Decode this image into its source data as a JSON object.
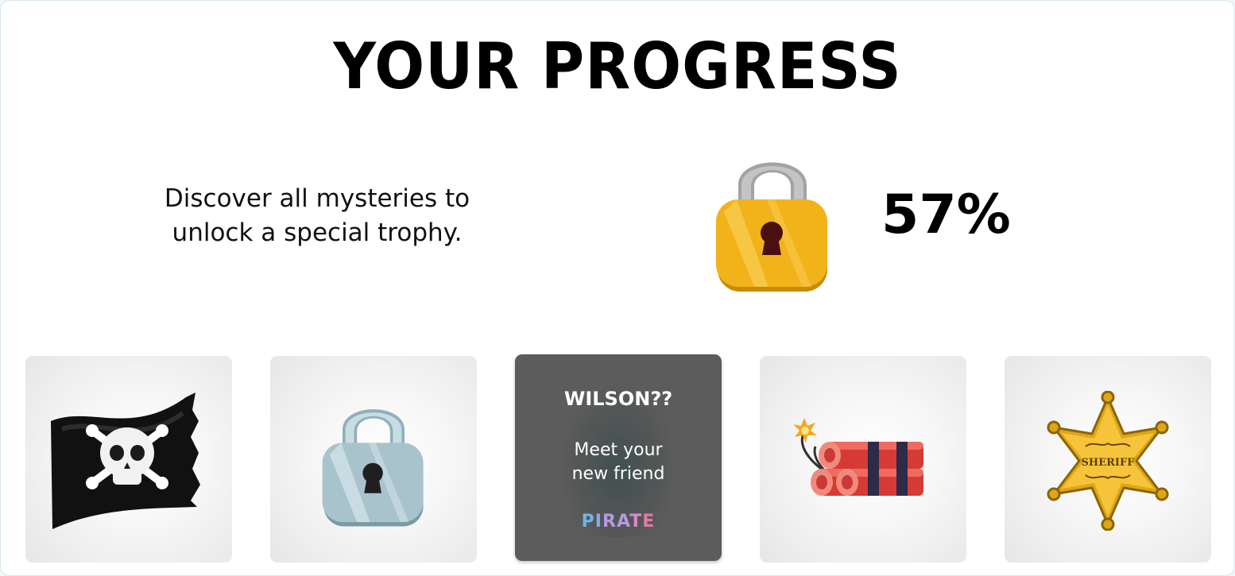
{
  "header": {
    "title": "YOUR PROGRESS"
  },
  "progress": {
    "description_line1": "Discover all mysteries to",
    "description_line2": "unlock a special trophy.",
    "percent_label": "57%",
    "percent_value": 57,
    "lock_icon": "padlock-gold-icon"
  },
  "cards": [
    {
      "icon": "pirate-flag-icon"
    },
    {
      "icon": "padlock-silver-icon"
    },
    {
      "icon": "hidden-character-icon",
      "title": "WILSON??",
      "text_line1": "Meet your",
      "text_line2": "new friend",
      "tag_letters": [
        "P",
        "I",
        "R",
        "A",
        "T",
        "E"
      ]
    },
    {
      "icon": "dynamite-icon"
    },
    {
      "icon": "sheriff-badge-icon",
      "badge_text": "SHERIFF"
    }
  ],
  "colors": {
    "page_bg": "#ffffff",
    "card_bg": "#f0f0f0",
    "active_card_bg": "#5c5c5c",
    "gold": "#f2b21a",
    "silver": "#a9c3cc",
    "dynamite_red": "#e8423e"
  }
}
